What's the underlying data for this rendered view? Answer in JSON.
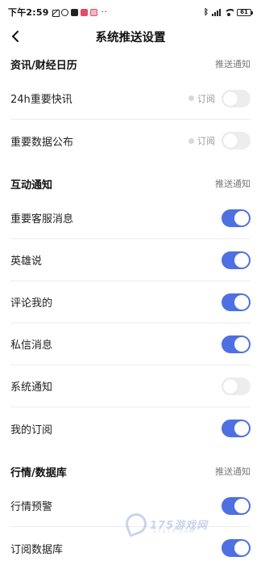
{
  "status_bar": {
    "time": "下午2:59",
    "dots": "··",
    "battery": "61"
  },
  "nav": {
    "title": "系统推送设置"
  },
  "sections": [
    {
      "title": "资讯/财经日历",
      "note": "推送通知",
      "items": [
        {
          "label": "24h重要快讯",
          "subscribe": "订阅",
          "enabled": false
        },
        {
          "label": "重要数据公布",
          "subscribe": "订阅",
          "enabled": false
        }
      ]
    },
    {
      "title": "互动通知",
      "note": "推送通知",
      "items": [
        {
          "label": "重要客服消息",
          "enabled": true
        },
        {
          "label": "英雄说",
          "enabled": true
        },
        {
          "label": "评论我的",
          "enabled": true
        },
        {
          "label": "私信消息",
          "enabled": true
        },
        {
          "label": "系统通知",
          "enabled": false
        },
        {
          "label": "我的订阅",
          "enabled": true
        }
      ]
    },
    {
      "title": "行情/数据库",
      "note": "推送通知",
      "items": [
        {
          "label": "行情预警",
          "enabled": true
        },
        {
          "label": "订阅数据库",
          "enabled": true
        }
      ]
    }
  ],
  "colors": {
    "toggle_on": "#4f70e2",
    "toggle_off": "#ededed"
  },
  "watermark": {
    "text": "175游戏网",
    "sub": "17173.COM"
  }
}
